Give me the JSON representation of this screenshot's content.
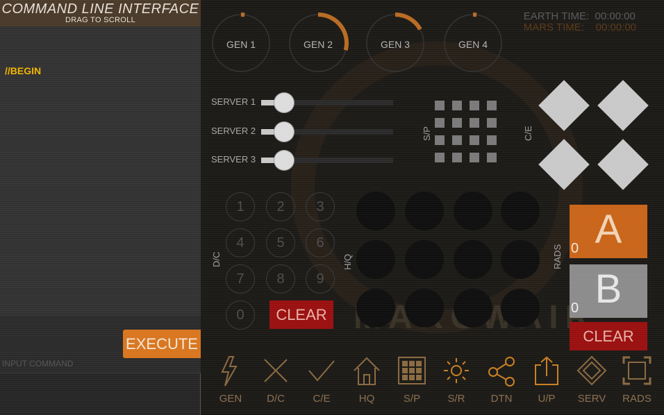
{
  "cli": {
    "title": "COMMAND LINE INTERFACE",
    "subtitle": "DRAG TO SCROLL",
    "log_line": "//BEGIN",
    "execute_label": "EXECUTE",
    "input_placeholder": "INPUT COMMAND",
    "input_value": ""
  },
  "clock": {
    "earth_label": "EARTH TIME:",
    "earth_value": "00:00:00",
    "mars_label": "MARS TIME:",
    "mars_value": "00:00:00"
  },
  "generators": [
    {
      "label": "GEN 1",
      "level": 0.02
    },
    {
      "label": "GEN 2",
      "level": 0.29
    },
    {
      "label": "GEN 3",
      "level": 0.17
    },
    {
      "label": "GEN 4",
      "level": 0.02
    }
  ],
  "servers": [
    {
      "label": "SERVER 1",
      "value": 0.1
    },
    {
      "label": "SERVER 2",
      "value": 0.1
    },
    {
      "label": "SERVER 3",
      "value": 0.1
    }
  ],
  "labels": {
    "sp": "S/P",
    "ce": "C/E",
    "dc": "D/C",
    "hq": "H/Q",
    "rads": "RADS",
    "bg_text": "MARCWAIR"
  },
  "keypad": {
    "keys": [
      "1",
      "2",
      "3",
      "4",
      "5",
      "6",
      "7",
      "8",
      "9",
      "0"
    ],
    "clear_label": "CLEAR"
  },
  "rads": {
    "a_label": "A",
    "a_count": "0",
    "b_label": "B",
    "b_count": "0",
    "clear_label": "CLEAR"
  },
  "nav": [
    {
      "label": "GEN",
      "icon": "lightning-icon"
    },
    {
      "label": "D/C",
      "icon": "x-icon"
    },
    {
      "label": "C/E",
      "icon": "check-icon"
    },
    {
      "label": "HQ",
      "icon": "home-icon"
    },
    {
      "label": "S/P",
      "icon": "grid-panel-icon"
    },
    {
      "label": "S/R",
      "icon": "sun-icon"
    },
    {
      "label": "DTN",
      "icon": "share-icon"
    },
    {
      "label": "U/P",
      "icon": "upload-icon"
    },
    {
      "label": "SERV",
      "icon": "diamond-icon"
    },
    {
      "label": "RADS",
      "icon": "frame-icon"
    }
  ],
  "colors": {
    "accent": "#d9761f",
    "danger": "#9a1010",
    "log_text": "#f2b400"
  }
}
